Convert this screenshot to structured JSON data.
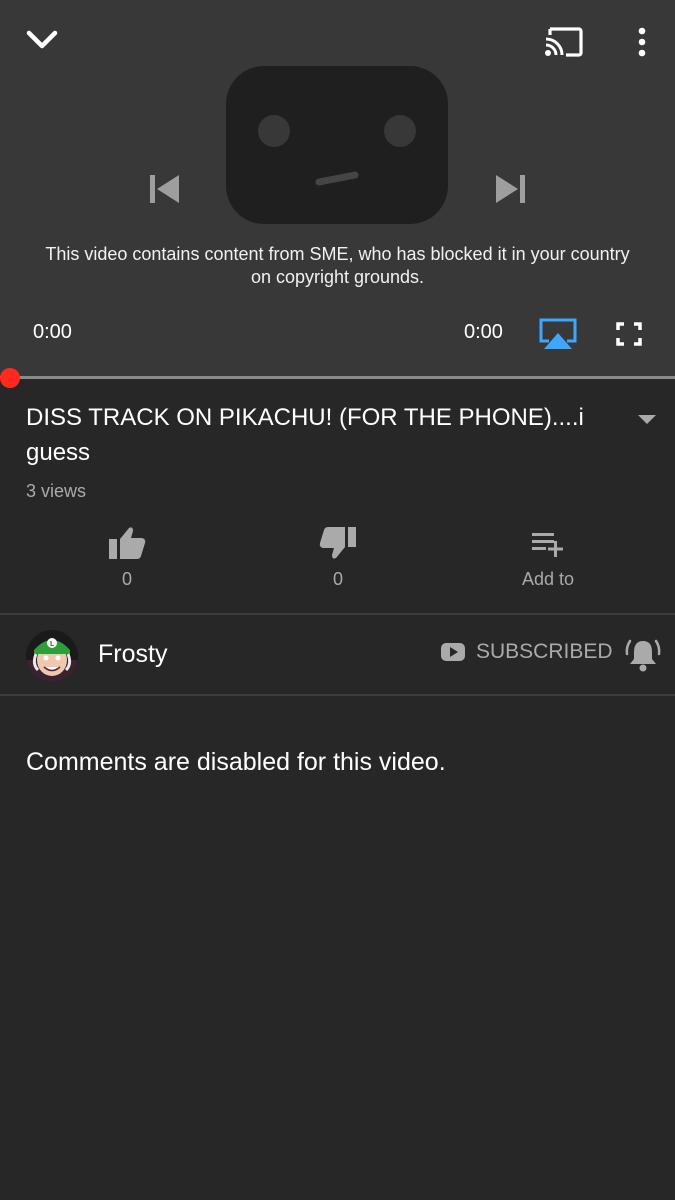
{
  "player": {
    "blocked_message": "This video contains content from SME, who has blocked it in your country on copyright grounds.",
    "current_time": "0:00",
    "duration": "0:00",
    "progress_fraction": 0,
    "icons": [
      "chevron-down-icon",
      "cast-icon",
      "more-vert-icon",
      "skip-previous-icon",
      "skip-next-icon",
      "airplay-icon",
      "fullscreen-icon"
    ],
    "accent_color": "#ff0000",
    "airplay_color": "#3ea6ff"
  },
  "video": {
    "title": "DISS TRACK ON PIKACHU! (FOR THE PHONE)....i guess",
    "views": "3 views"
  },
  "actions": {
    "like_count": "0",
    "dislike_count": "0",
    "add_to_label": "Add to"
  },
  "channel": {
    "name": "Frosty",
    "subscribe_label": "SUBSCRIBED"
  },
  "comments": {
    "disabled_message": "Comments are disabled for this video."
  }
}
